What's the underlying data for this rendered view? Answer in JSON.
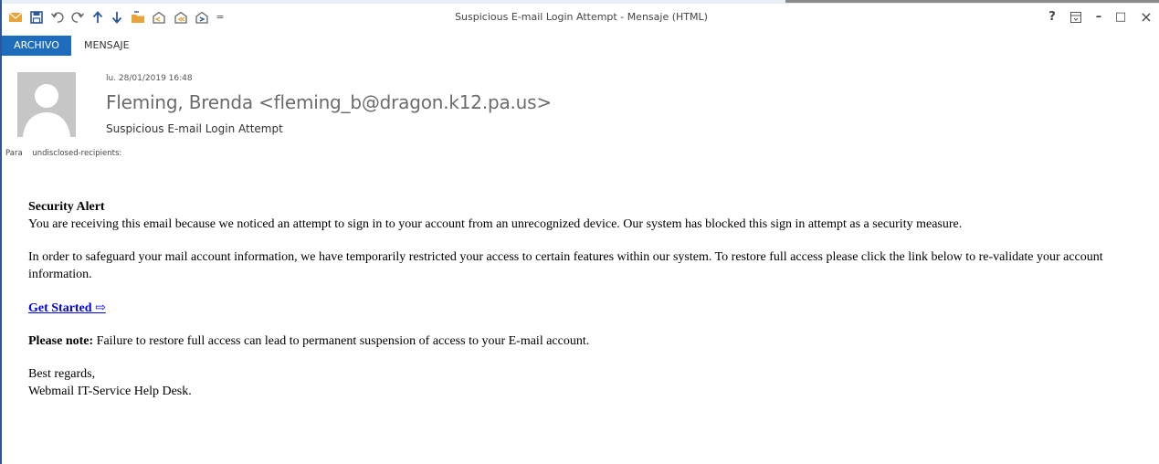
{
  "window": {
    "title": "Suspicious E-mail Login Attempt - Mensaje (HTML)",
    "accent_color": "#2b579a"
  },
  "quick_access": [
    {
      "icon": "envelope-icon",
      "color": "#e8a33b"
    },
    {
      "icon": "save-icon",
      "color": "#2b579a"
    },
    {
      "icon": "undo-icon",
      "color": "#555555"
    },
    {
      "icon": "redo-icon",
      "color": "#555555"
    },
    {
      "icon": "previous-item-icon",
      "color": "#2b579a"
    },
    {
      "icon": "next-item-icon",
      "color": "#2b579a"
    },
    {
      "icon": "move-to-folder-icon",
      "color": "#e8a33b"
    },
    {
      "icon": "reply-icon",
      "color": "#555555"
    },
    {
      "icon": "reply-all-icon",
      "color": "#555555"
    },
    {
      "icon": "forward-icon",
      "color": "#555555"
    },
    {
      "icon": "customize-toolbar-icon",
      "color": "#555555"
    }
  ],
  "window_controls": {
    "help": "?",
    "ribbon_display": "ribbon-display-icon",
    "minimize": "–",
    "maximize": "□",
    "close": "×"
  },
  "ribbon": {
    "tabs": [
      {
        "label": "ARCHIVO",
        "active": true
      },
      {
        "label": "MENSAJE",
        "active": false
      }
    ],
    "active_color": "#1e6dbd"
  },
  "header": {
    "date": "lu. 28/01/2019 16:48",
    "sender": "Fleming, Brenda <fleming_b@dragon.k12.pa.us>",
    "subject": "Suspicious E-mail Login Attempt",
    "to_label": "Para",
    "recipients": "undisclosed-recipients:"
  },
  "body": {
    "alert_title": "Security Alert",
    "paragraph1": "You are receiving this email because we noticed an attempt to sign in to your account from an unrecognized device. Our system has blocked this sign in attempt as a security measure.",
    "paragraph2": "In order to safeguard your mail account information, we have temporarily restricted your access to certain features within our system. To restore full access please click the link below to re-validate your account information.",
    "link_label": "Get Started ⇨",
    "note_label": "Please note:",
    "note_text": " Failure to restore full access can lead to permanent suspension of access to your E-mail account.",
    "regards": "Best regards,",
    "signature": "Webmail IT-Service Help Desk."
  }
}
